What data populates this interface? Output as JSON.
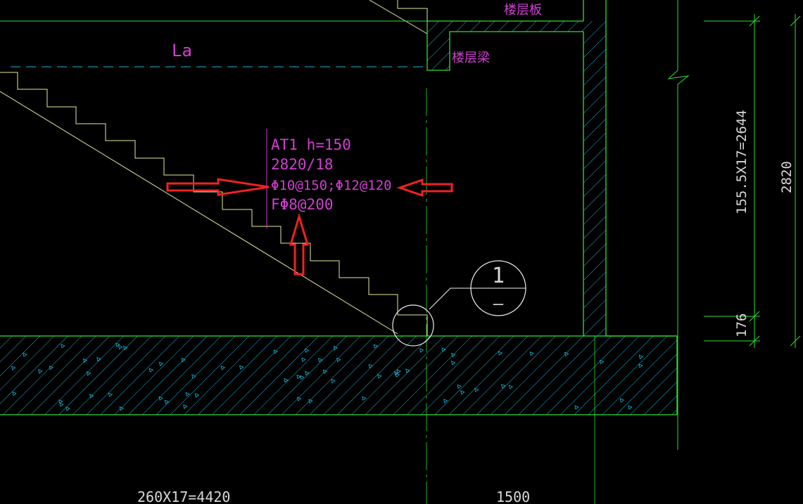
{
  "drawing": {
    "labels": {
      "floor_slab": "楼层板",
      "floor_beam": "楼层梁",
      "anchorage": "La"
    },
    "annotation": {
      "line1": "AT1 h=150",
      "line2": "2820/18",
      "line3": "Φ10@150;Φ12@120",
      "line4": "FΦ8@200"
    },
    "section_mark": {
      "number": "1",
      "sheet": "–"
    },
    "dimensions": {
      "bottom_left": "260X17=4420",
      "bottom_right": "1500",
      "right_inner": "155.5X17=2644",
      "right_outer": "2820",
      "right_small": "176"
    },
    "colors": {
      "background": "#000000",
      "stair_line": "#e8e8a0",
      "wall_line": "#33dd33",
      "hatch": "#1fb5d8",
      "text": "#d040d0",
      "dimension_text": "#d8d8d8",
      "highlight_arrow": "#ee2222"
    }
  }
}
